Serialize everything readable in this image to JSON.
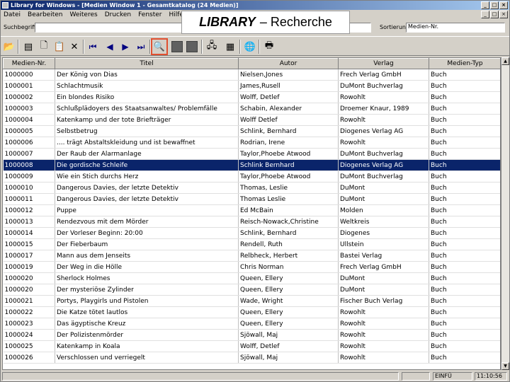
{
  "window": {
    "title": "Library for Windows - [Medien Window 1 - Gesamtkatalog (24 Medien)]",
    "controls": [
      "_",
      "□",
      "×"
    ]
  },
  "menu": [
    "Datei",
    "Bearbeiten",
    "Weiteres",
    "Drucken",
    "Fenster",
    "Hilfe"
  ],
  "overlay": {
    "brand": "LIBRARY",
    "subtitle": "– Recherche"
  },
  "search": {
    "label": "Suchbegriff",
    "value": "",
    "sort_label": "Sortierung",
    "sort_value": "Medien-Nr."
  },
  "table": {
    "columns": [
      "Medien-Nr.",
      "Titel",
      "Autor",
      "Verlag",
      "Medien-Typ"
    ],
    "selected_index": 8,
    "rows": [
      [
        "1000000",
        "Der König von Dias",
        "Nielsen,Jones",
        "Frech Verlag GmbH",
        "Buch"
      ],
      [
        "1000001",
        "Schlachtmusik",
        "James,Rusell",
        "DuMont Buchverlag",
        "Buch"
      ],
      [
        "1000002",
        "Ein blondes Risiko",
        "Wolff, Detlef",
        "Rowohlt",
        "Buch"
      ],
      [
        "1000003",
        "Schlußplädoyers des Staatsanwaltes/ Problemfälle",
        "Schabin, Alexander",
        "Droemer Knaur, 1989",
        "Buch"
      ],
      [
        "1000004",
        "Katenkamp und der tote Briefträger",
        "Wolff Detlef",
        "Rowohlt",
        "Buch"
      ],
      [
        "1000005",
        "Selbstbetrug",
        "Schlink, Bernhard",
        "Diogenes Verlag AG",
        "Buch"
      ],
      [
        "1000006",
        ".... trägt Abstaltskleidung und ist bewaffnet",
        "Rodrian, Irene",
        "Rowohlt",
        "Buch"
      ],
      [
        "1000007",
        "Der Raub der Alarmanlage",
        "Taylor,Phoebe Atwood",
        "DuMont Buchverlag",
        "Buch"
      ],
      [
        "1000008",
        "Die gordische Schleife",
        "Schlink Bernhard",
        "Diogenes Verlag AG",
        "Buch"
      ],
      [
        "1000009",
        "Wie ein Stich durchs Herz",
        "Taylor,Phoebe Atwood",
        "DuMont Buchverlag",
        "Buch"
      ],
      [
        "1000010",
        "Dangerous Davies, der letzte Detektiv",
        "Thomas, Leslie",
        "DuMont",
        "Buch"
      ],
      [
        "1000011",
        "Dangerous Davies, der letzte Detektiv",
        "Thomas Leslie",
        "DuMont",
        "Buch"
      ],
      [
        "1000012",
        "Puppe",
        "Ed McBain",
        "Molden",
        "Buch"
      ],
      [
        "1000013",
        "Rendezvous mit dem Mörder",
        "Reisch-Nowack,Christine",
        "Weltkreis",
        "Buch"
      ],
      [
        "1000014",
        "Der Vorleser Beginn: 20:00",
        "Schlink, Bernhard",
        "Diogenes",
        "Buch"
      ],
      [
        "1000015",
        "Der Fieberbaum",
        "Rendell, Ruth",
        "Ullstein",
        "Buch"
      ],
      [
        "1000017",
        "Mann aus dem Jenseits",
        "Relbheck, Herbert",
        "Bastei Verlag",
        "Buch"
      ],
      [
        "1000019",
        "Der Weg in die Hölle",
        "Chris Norman",
        "Frech Verlag GmbH",
        "Buch"
      ],
      [
        "1000020",
        "Sherlock Holmes",
        "Queen, Ellery",
        "DuMont",
        "Buch"
      ],
      [
        "1000020",
        "Der mysteriöse Zylinder",
        "Queen, Ellery",
        "DuMont",
        "Buch"
      ],
      [
        "1000021",
        "Portys, Playgirls und Pistolen",
        "Wade, Wright",
        "Fischer Buch Verlag",
        "Buch"
      ],
      [
        "1000022",
        "Die Katze tötet lautlos",
        "Queen, Ellery",
        "Rowohlt",
        "Buch"
      ],
      [
        "1000023",
        "Das ägyptische Kreuz",
        "Queen, Ellery",
        "Rowohlt",
        "Buch"
      ],
      [
        "1000024",
        "Der Polizistenmörder",
        "Sjöwall, Maj",
        "Rowohlt",
        "Buch"
      ],
      [
        "1000025",
        "Katenkamp in Koala",
        "Wolff, Detlef",
        "Rowohlt",
        "Buch"
      ],
      [
        "1000026",
        "Verschlossen und verriegelt",
        "Sjöwall, Maj",
        "Rowohlt",
        "Buch"
      ]
    ]
  },
  "status": {
    "mode": "EINFÜ",
    "time": "11:10:56"
  },
  "accent": {
    "selection": "#0a246a",
    "highlight": "#e05030"
  }
}
